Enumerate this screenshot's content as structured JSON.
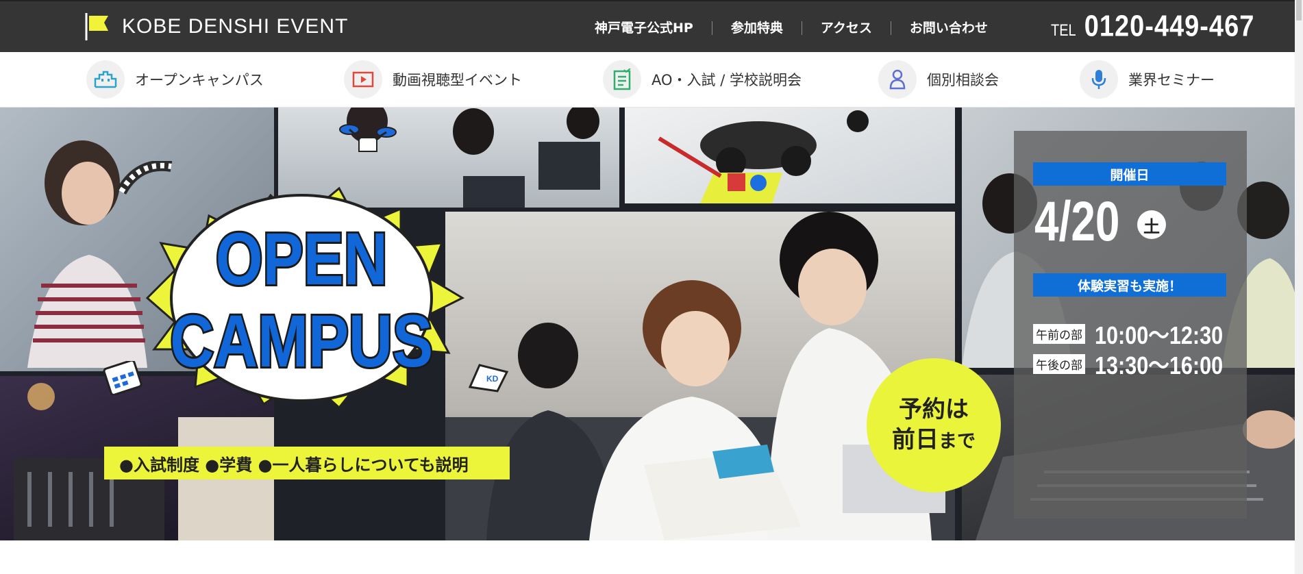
{
  "header": {
    "brand": "KOBE DENSHI EVENT",
    "nav": [
      "神戸電子公式HP",
      "参加特典",
      "アクセス",
      "お問い合わせ"
    ],
    "tel_label": "TEL",
    "tel_number": "0120-449-467"
  },
  "subnav": {
    "items": [
      {
        "label": "オープンキャンパス",
        "icon": "building-icon",
        "color": "#2aa3c8"
      },
      {
        "label": "動画視聴型イベント",
        "icon": "video-play-icon",
        "color": "#e0493a"
      },
      {
        "label": "AO・入試 / 学校説明会",
        "icon": "document-check-icon",
        "color": "#2fae6d"
      },
      {
        "label": "個別相談会",
        "icon": "person-icon",
        "color": "#5b6fd6"
      },
      {
        "label": "業界セミナー",
        "icon": "microphone-icon",
        "color": "#2f7fd8"
      }
    ]
  },
  "hero": {
    "title_line1": "OPEN",
    "title_line2": "CAMPUS",
    "band_text": "●入試制度 ●学費 ●一人暮らしについても説明",
    "bubble_line1": "予約は",
    "bubble_line2_main": "前日",
    "bubble_line2_small": "まで",
    "kp_tag": "KD",
    "event_label": "開催日",
    "date": "4/20",
    "weekday": "土",
    "experience": "体験実習も実施！",
    "slots": [
      {
        "tag": "午前の部",
        "time": "10:00〜12:30"
      },
      {
        "tag": "午後の部",
        "time": "13:30〜16:00"
      }
    ],
    "accent_yellow": "#ecf53a",
    "accent_blue": "#0f6fd6"
  }
}
